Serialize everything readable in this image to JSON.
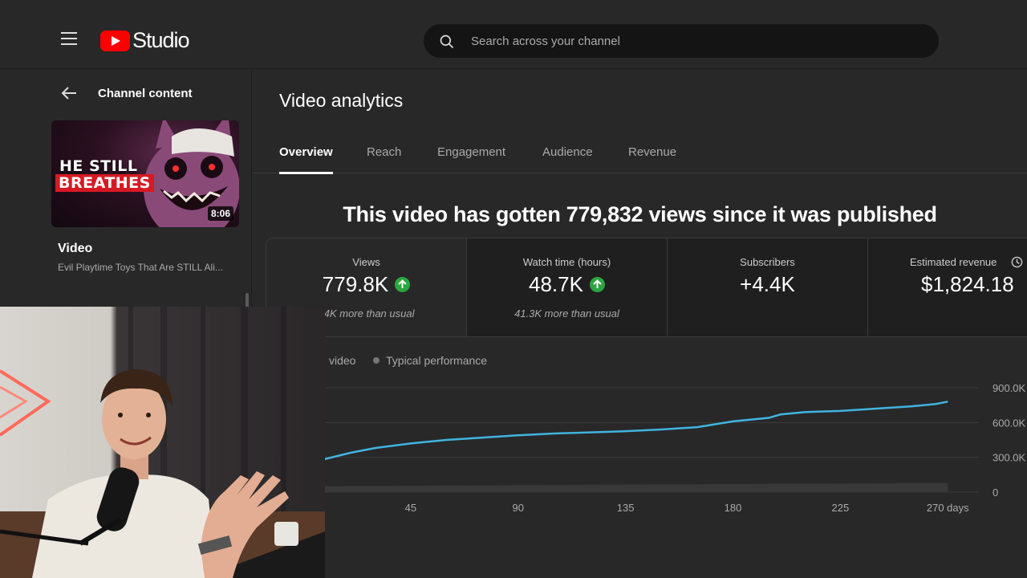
{
  "header": {
    "logo_text": "Studio",
    "search_placeholder": "Search across your channel"
  },
  "sidebar": {
    "back_label": "Channel content",
    "thumbnail": {
      "line1": "HE STILL",
      "line2": "BREATHES",
      "duration": "8:06"
    },
    "video_label": "Video",
    "video_title": "Evil Playtime Toys That Are STILL Ali..."
  },
  "main": {
    "title": "Video analytics",
    "tabs": [
      "Overview",
      "Reach",
      "Engagement",
      "Audience",
      "Revenue"
    ],
    "active_tab": "Overview",
    "headline": "This video has gotten 779,832 views since it was published",
    "metrics": [
      {
        "label": "Views",
        "value": "779.8K",
        "trend": "up",
        "sub": "..4K more than usual"
      },
      {
        "label": "Watch time (hours)",
        "value": "48.7K",
        "trend": "up",
        "sub": "41.3K more than usual"
      },
      {
        "label": "Subscribers",
        "value": "+4.4K",
        "trend": "",
        "sub": ""
      },
      {
        "label": "Estimated revenue",
        "value": "$1,824.18",
        "trend": "",
        "sub": ""
      }
    ],
    "legend": {
      "this_video": "video",
      "typical": "Typical performance"
    }
  },
  "colors": {
    "line": "#41b4e0",
    "band": "#3a3a3a",
    "accent_up": "#2ba640",
    "brand": "#ff0000"
  },
  "chart_data": {
    "type": "line",
    "xlabel": "",
    "ylabel": "",
    "x_ticks": [
      "45",
      "90",
      "135",
      "180",
      "225",
      "270 days"
    ],
    "y_ticks": [
      "900.0K",
      "600.0K",
      "300.0K",
      "0"
    ],
    "xlim": [
      0,
      280
    ],
    "ylim": [
      0,
      900000
    ],
    "series": [
      {
        "name": "video",
        "x": [
          0,
          10,
          20,
          30,
          45,
          60,
          75,
          90,
          105,
          120,
          135,
          150,
          165,
          180,
          195,
          200,
          210,
          225,
          240,
          255,
          265,
          270
        ],
        "y": [
          230000,
          290000,
          340000,
          380000,
          420000,
          450000,
          470000,
          490000,
          505000,
          515000,
          525000,
          540000,
          560000,
          610000,
          640000,
          670000,
          690000,
          700000,
          720000,
          740000,
          760000,
          780000
        ]
      },
      {
        "name": "Typical performance",
        "x": [
          0,
          270
        ],
        "y": [
          20000,
          50000
        ]
      }
    ]
  }
}
